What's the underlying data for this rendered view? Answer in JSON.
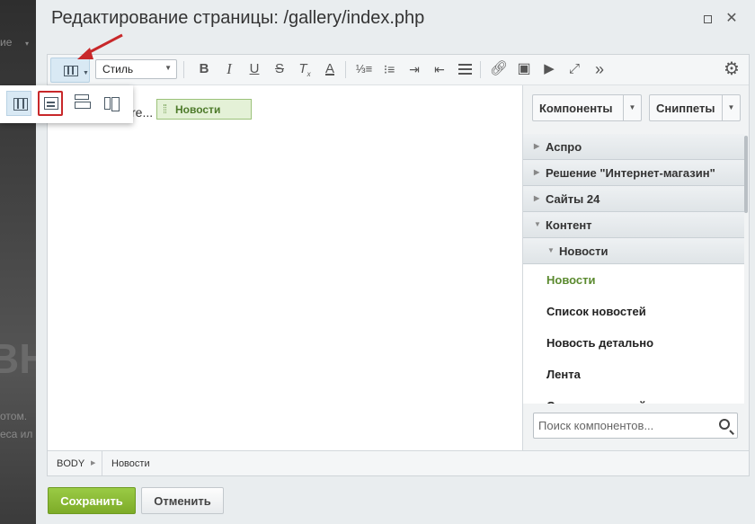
{
  "backdrop": {
    "fragment_1": "ие",
    "fragment_big": "ВН",
    "fragment_2": "отом.",
    "fragment_3": "еса ил"
  },
  "dialog": {
    "title": "Редактирование страницы: /gallery/index.php"
  },
  "toolbar": {
    "style_select": "Стиль",
    "icons": [
      "view-mode-icon",
      "bold-icon",
      "italic-icon",
      "underline-icon",
      "strikethrough-icon",
      "clear-format-icon",
      "font-color-icon",
      "ordered-list-icon",
      "unordered-list-icon",
      "indent-icon",
      "outdent-icon",
      "align-icon",
      "link-icon",
      "image-icon",
      "video-icon",
      "fullscreen-icon",
      "more-icon",
      "settings-icon"
    ]
  },
  "editor": {
    "content_text": "re...",
    "component_chip": "Новости"
  },
  "panel": {
    "tab_components": "Компоненты",
    "tab_snippets": "Сниппеты",
    "groups": [
      {
        "label": "Аспро"
      },
      {
        "label": "Решение \"Интернет-магазин\""
      },
      {
        "label": "Сайты 24"
      },
      {
        "label": "Контент"
      }
    ],
    "subgroup": "Новости",
    "leaves": [
      {
        "label": "Новости"
      },
      {
        "label": "Список новостей"
      },
      {
        "label": "Новость детально"
      },
      {
        "label": "Лента"
      },
      {
        "label": "Список новостей для ленты"
      }
    ],
    "search_placeholder": "Поиск компонентов..."
  },
  "statusbar": {
    "body": "BODY",
    "item": "Новости"
  },
  "buttons": {
    "save": "Сохранить",
    "cancel": "Отменить"
  },
  "colors": {
    "accent_green": "#7dab28",
    "highlight_red": "#c8282a",
    "active_leaf": "#5b8a2f"
  }
}
